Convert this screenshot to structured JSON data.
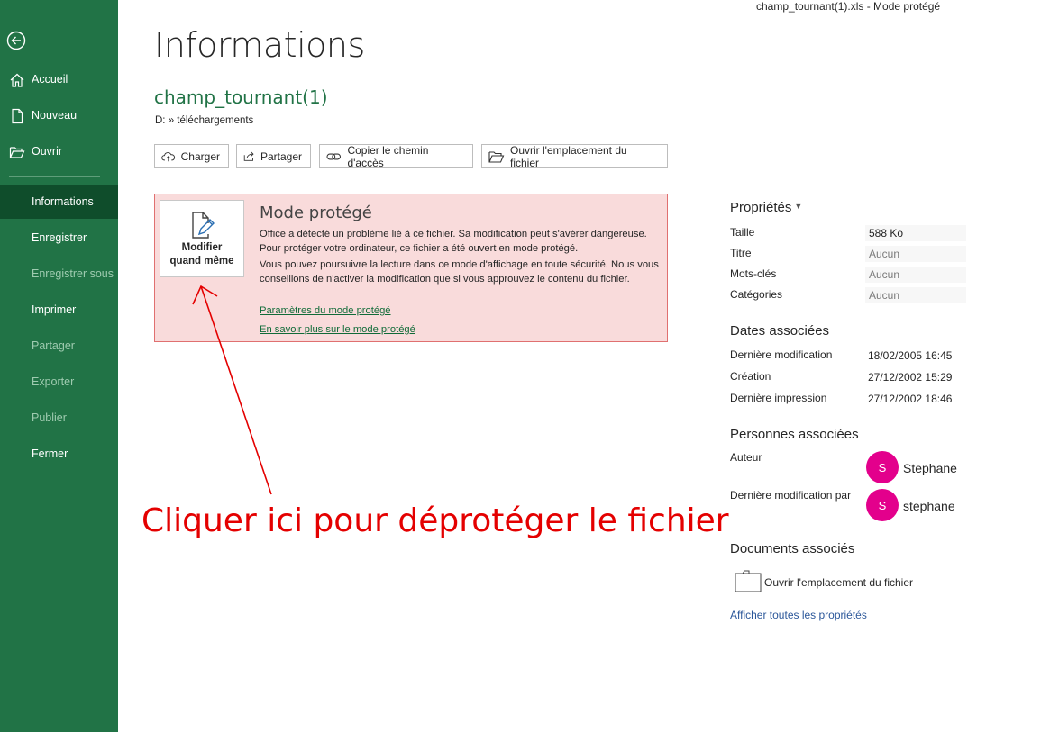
{
  "window": {
    "doc_title": "champ_tournant(1).xls  -  Mode protégé"
  },
  "sidebar": {
    "items": [
      {
        "label": "Accueil"
      },
      {
        "label": "Nouveau"
      },
      {
        "label": "Ouvrir"
      },
      {
        "label": "Informations"
      },
      {
        "label": "Enregistrer"
      },
      {
        "label": "Enregistrer sous"
      },
      {
        "label": "Imprimer"
      },
      {
        "label": "Partager"
      },
      {
        "label": "Exporter"
      },
      {
        "label": "Publier"
      },
      {
        "label": "Fermer"
      }
    ]
  },
  "main": {
    "title": "Informations",
    "file_name": "champ_tournant(1)",
    "path": "D: » téléchargements",
    "toolbar": {
      "upload": "Charger",
      "share": "Partager",
      "copy_path": "Copier le chemin d'accès",
      "open_location": "Ouvrir l'emplacement du fichier"
    }
  },
  "protected_mode": {
    "button_line1": "Modifier",
    "button_line2": "quand même",
    "title": "Mode protégé",
    "text1": "Office a détecté un problème lié à ce fichier. Sa modification peut s'avérer dangereuse. Pour protéger votre ordinateur, ce fichier a été ouvert en mode protégé.",
    "text2": "Vous pouvez poursuivre la lecture dans ce mode d'affichage en toute sécurité. Nous vous conseillons de n'activer la modification que si vous approuvez le contenu du fichier.",
    "link_settings": "Paramètres du mode protégé",
    "link_learn": "En savoir plus sur le mode protégé"
  },
  "annotation": {
    "text": "Cliquer ici pour déprotéger le fichier",
    "color": "#e40000"
  },
  "properties": {
    "title": "Propriétés",
    "size_label": "Taille",
    "size_value": "588 Ko",
    "title_label": "Titre",
    "title_value": "Aucun",
    "keywords_label": "Mots-clés",
    "keywords_value": "Aucun",
    "categories_label": "Catégories",
    "categories_value": "Aucun"
  },
  "dates": {
    "section": "Dates associées",
    "modified_label": "Dernière modification",
    "modified_value": "18/02/2005 16:45",
    "created_label": "Création",
    "created_value": "27/12/2002 15:29",
    "printed_label": "Dernière impression",
    "printed_value": "27/12/2002 18:46"
  },
  "people": {
    "section": "Personnes associées",
    "author_label": "Auteur",
    "author_initial": "S",
    "author_name": "Stephane",
    "modified_by_label": "Dernière modification par",
    "modified_by_initial": "S",
    "modified_by_name": "stephane"
  },
  "documents": {
    "section": "Documents associés",
    "open_location": "Ouvrir l'emplacement du fichier",
    "show_all": "Afficher toutes les propriétés"
  },
  "colors": {
    "excel_green": "#217346",
    "sidebar_active": "#0f4d2b",
    "protected_bg": "#f9dbdb",
    "avatar": "#e3008c",
    "link_blue": "#2b579a"
  }
}
